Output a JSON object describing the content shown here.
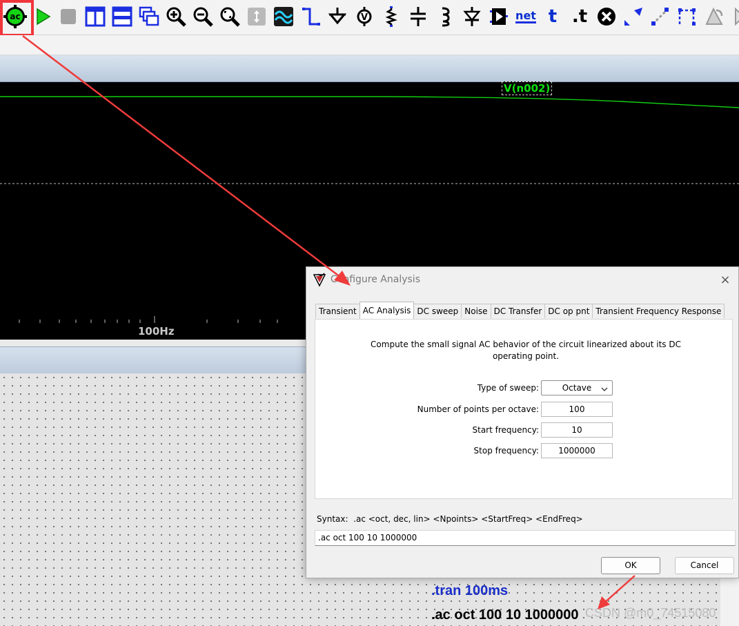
{
  "toolbar": {
    "icons": [
      "ac-run-icon",
      "run-icon",
      "halt-icon",
      "tile-vertical-icon",
      "tile-horizontal-icon",
      "cascade-icon",
      "zoom-in-icon",
      "zoom-out-icon",
      "zoom-fit-icon",
      "pan-icon",
      "waveform-icon",
      "wire-icon",
      "ground-icon",
      "voltage-probe-icon",
      "resistor-icon",
      "capacitor-icon",
      "inductor-icon",
      "diode-icon",
      "component-icon",
      "net-label-icon",
      "text-icon",
      "spice-directive-icon",
      "delete-icon",
      "move-icon",
      "drag-icon",
      "rotate-icon",
      "mirror-icon",
      "more-icon"
    ],
    "net_label": "net",
    "text_label": "t",
    "spice_label": ".t",
    "accent_color": "#1b2ee0",
    "highlight_color": "#f0363c"
  },
  "plot": {
    "trace_label": "V(n002)",
    "trace_color": "#10e010",
    "x_tick": "100Hz",
    "background": "#000000"
  },
  "schematic": {
    "directive_tran": ".tran 100ms",
    "directive_ac": ".ac oct 100 10 1000000",
    "watermark": "CSDN @m0_74515080"
  },
  "dialog": {
    "title": "Configure Analysis",
    "close": "×",
    "tabs": [
      "Transient",
      "AC Analysis",
      "DC sweep",
      "Noise",
      "DC Transfer",
      "DC op pnt",
      "Transient Frequency Response"
    ],
    "active_tab": "AC Analysis",
    "description": "Compute the small signal AC behavior of the circuit linearized about its DC operating point.",
    "fields": {
      "sweep_type": {
        "label": "Type of sweep:",
        "value": "Octave"
      },
      "points": {
        "label": "Number of points per octave:",
        "value": "100"
      },
      "start": {
        "label": "Start frequency:",
        "value": "10"
      },
      "stop": {
        "label": "Stop frequency:",
        "value": "1000000"
      }
    },
    "syntax": "Syntax:  .ac <oct, dec, lin> <Npoints> <StartFreq> <EndFreq>",
    "command": ".ac oct 100 10 1000000",
    "ok": "OK",
    "cancel": "Cancel"
  }
}
